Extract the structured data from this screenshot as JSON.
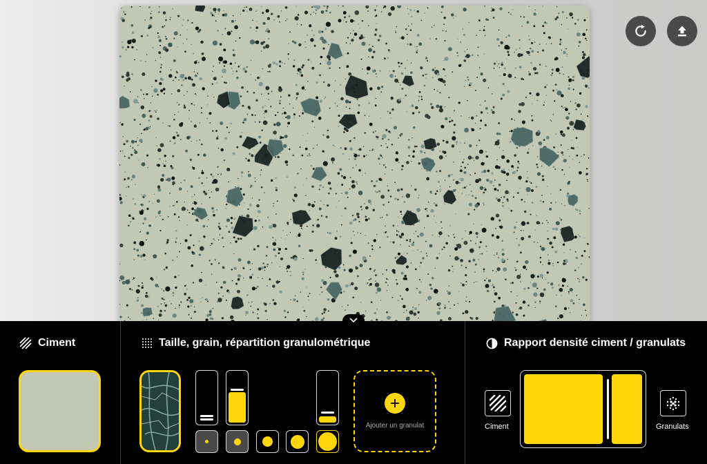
{
  "colors": {
    "accent": "#ffd60a",
    "cement": "#c2c8b4",
    "panel": "#000000"
  },
  "toolbar": {
    "reset_icon": "refresh-icon",
    "export_icon": "upload-icon"
  },
  "sections": {
    "cement": {
      "title": "Ciment",
      "icon": "hatch-icon"
    },
    "granulometry": {
      "title": "Taille, grain, répartition granulométrique",
      "icon": "dot-grid-icon",
      "add_label": "Ajouter un granulat",
      "sliders": [
        {
          "level": 0.1
        },
        {
          "level": 0.65
        },
        null,
        null,
        {
          "level": 0.15
        }
      ],
      "sizes": [
        "xs",
        "s",
        "m",
        "l",
        "xl"
      ]
    },
    "ratio": {
      "title": "Rapport densité ciment / granulats",
      "icon": "half-circle-icon",
      "cement_label": "Ciment",
      "granulats_label": "Granulats",
      "cement_share": 0.72
    }
  }
}
